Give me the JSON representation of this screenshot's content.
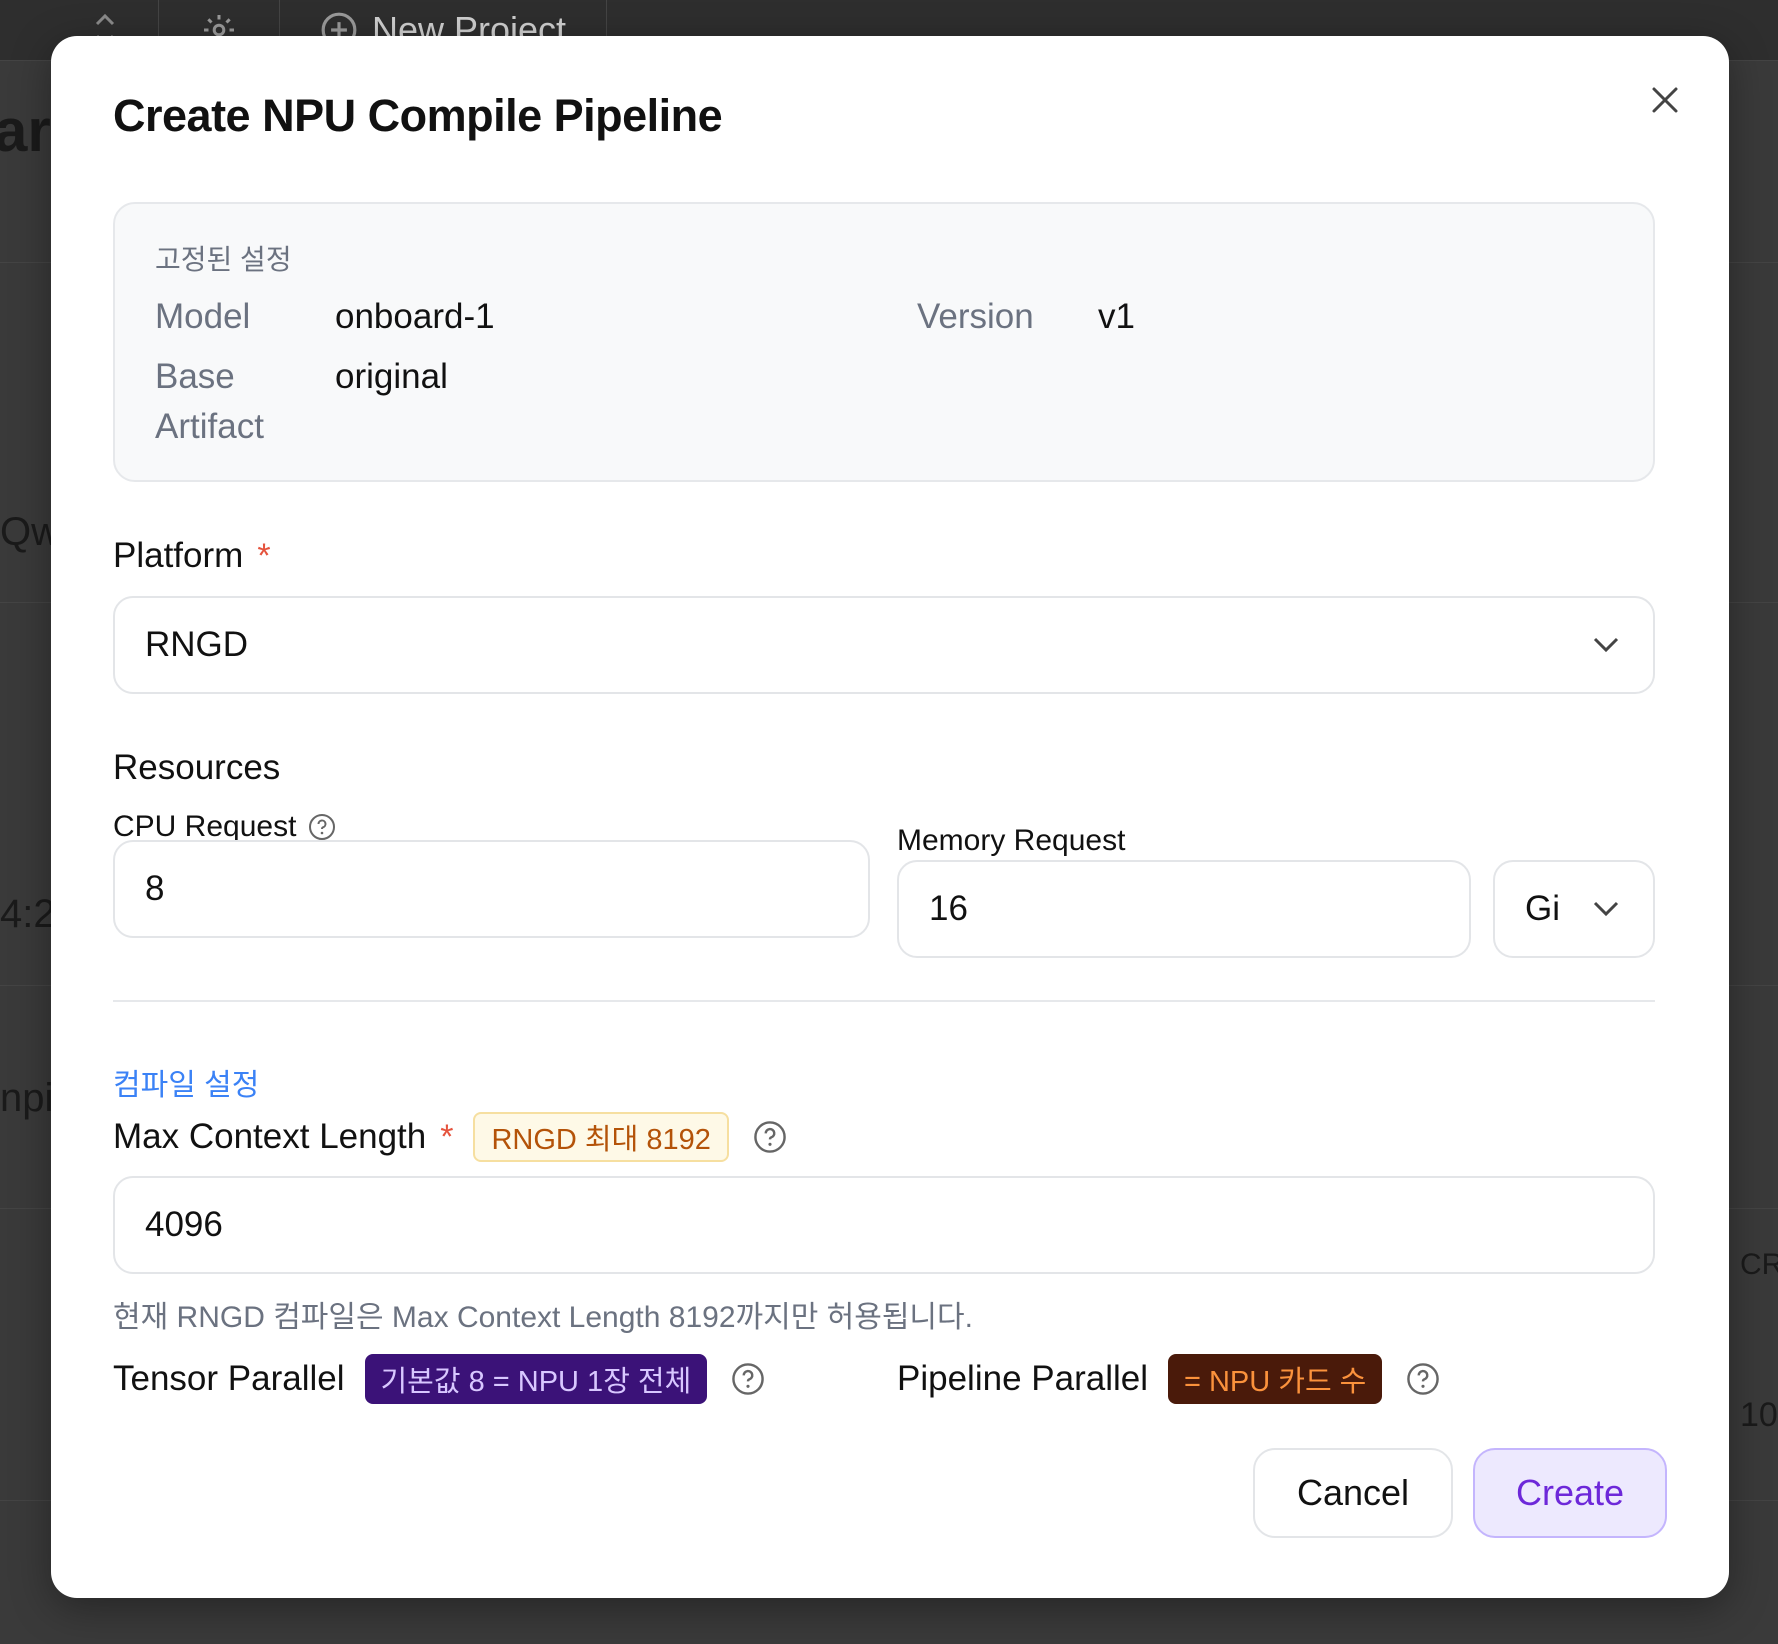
{
  "background": {
    "topbar": {
      "new_project_label": "New Project"
    },
    "side_fragments": [
      "ard",
      "Qw",
      "4:2",
      "npil"
    ],
    "right_fragments": [
      "CR",
      "10"
    ]
  },
  "modal": {
    "title": "Create NPU Compile Pipeline",
    "fixed_settings": {
      "header": "고정된 설정",
      "model_label": "Model",
      "model_value": "onboard-1",
      "version_label": "Version",
      "version_value": "v1",
      "base_label_line1": "Base",
      "base_label_line2": "Artifact",
      "base_value": "original"
    },
    "platform": {
      "label": "Platform",
      "required_mark": "*",
      "value": "RNGD"
    },
    "resources": {
      "title": "Resources",
      "cpu_label": "CPU Request",
      "cpu_value": "8",
      "memory_label": "Memory Request",
      "memory_value": "16",
      "memory_unit": "Gi"
    },
    "compile": {
      "section_title": "컴파일 설정",
      "max_context_label": "Max Context Length",
      "required_mark": "*",
      "max_context_badge": "RNGD 최대 8192",
      "max_context_value": "4096",
      "hint": "현재 RNGD 컴파일은 Max Context Length 8192까지만 허용됩니다.",
      "tensor_label": "Tensor Parallel",
      "tensor_badge": "기본값 8 = NPU 1장 전체",
      "pipeline_label": "Pipeline Parallel",
      "pipeline_badge": "= NPU 카드 수"
    },
    "actions": {
      "cancel": "Cancel",
      "create": "Create"
    },
    "colors": {
      "accent": "#6d28d9",
      "link": "#3b82f6",
      "required": "#e5533d"
    }
  }
}
